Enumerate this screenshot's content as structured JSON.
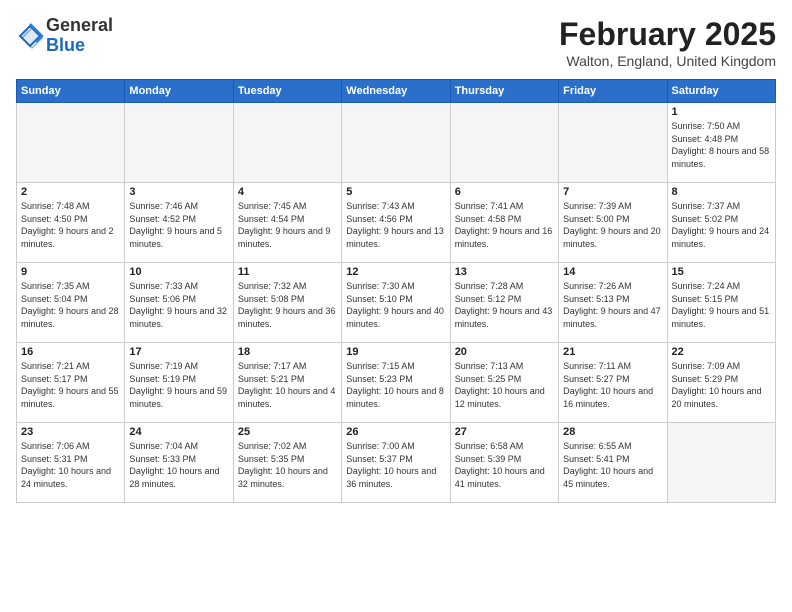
{
  "header": {
    "logo_general": "General",
    "logo_blue": "Blue",
    "month": "February 2025",
    "location": "Walton, England, United Kingdom"
  },
  "weekdays": [
    "Sunday",
    "Monday",
    "Tuesday",
    "Wednesday",
    "Thursday",
    "Friday",
    "Saturday"
  ],
  "weeks": [
    [
      {
        "day": "",
        "info": ""
      },
      {
        "day": "",
        "info": ""
      },
      {
        "day": "",
        "info": ""
      },
      {
        "day": "",
        "info": ""
      },
      {
        "day": "",
        "info": ""
      },
      {
        "day": "",
        "info": ""
      },
      {
        "day": "1",
        "info": "Sunrise: 7:50 AM\nSunset: 4:48 PM\nDaylight: 8 hours and 58 minutes."
      }
    ],
    [
      {
        "day": "2",
        "info": "Sunrise: 7:48 AM\nSunset: 4:50 PM\nDaylight: 9 hours and 2 minutes."
      },
      {
        "day": "3",
        "info": "Sunrise: 7:46 AM\nSunset: 4:52 PM\nDaylight: 9 hours and 5 minutes."
      },
      {
        "day": "4",
        "info": "Sunrise: 7:45 AM\nSunset: 4:54 PM\nDaylight: 9 hours and 9 minutes."
      },
      {
        "day": "5",
        "info": "Sunrise: 7:43 AM\nSunset: 4:56 PM\nDaylight: 9 hours and 13 minutes."
      },
      {
        "day": "6",
        "info": "Sunrise: 7:41 AM\nSunset: 4:58 PM\nDaylight: 9 hours and 16 minutes."
      },
      {
        "day": "7",
        "info": "Sunrise: 7:39 AM\nSunset: 5:00 PM\nDaylight: 9 hours and 20 minutes."
      },
      {
        "day": "8",
        "info": "Sunrise: 7:37 AM\nSunset: 5:02 PM\nDaylight: 9 hours and 24 minutes."
      }
    ],
    [
      {
        "day": "9",
        "info": "Sunrise: 7:35 AM\nSunset: 5:04 PM\nDaylight: 9 hours and 28 minutes."
      },
      {
        "day": "10",
        "info": "Sunrise: 7:33 AM\nSunset: 5:06 PM\nDaylight: 9 hours and 32 minutes."
      },
      {
        "day": "11",
        "info": "Sunrise: 7:32 AM\nSunset: 5:08 PM\nDaylight: 9 hours and 36 minutes."
      },
      {
        "day": "12",
        "info": "Sunrise: 7:30 AM\nSunset: 5:10 PM\nDaylight: 9 hours and 40 minutes."
      },
      {
        "day": "13",
        "info": "Sunrise: 7:28 AM\nSunset: 5:12 PM\nDaylight: 9 hours and 43 minutes."
      },
      {
        "day": "14",
        "info": "Sunrise: 7:26 AM\nSunset: 5:13 PM\nDaylight: 9 hours and 47 minutes."
      },
      {
        "day": "15",
        "info": "Sunrise: 7:24 AM\nSunset: 5:15 PM\nDaylight: 9 hours and 51 minutes."
      }
    ],
    [
      {
        "day": "16",
        "info": "Sunrise: 7:21 AM\nSunset: 5:17 PM\nDaylight: 9 hours and 55 minutes."
      },
      {
        "day": "17",
        "info": "Sunrise: 7:19 AM\nSunset: 5:19 PM\nDaylight: 9 hours and 59 minutes."
      },
      {
        "day": "18",
        "info": "Sunrise: 7:17 AM\nSunset: 5:21 PM\nDaylight: 10 hours and 4 minutes."
      },
      {
        "day": "19",
        "info": "Sunrise: 7:15 AM\nSunset: 5:23 PM\nDaylight: 10 hours and 8 minutes."
      },
      {
        "day": "20",
        "info": "Sunrise: 7:13 AM\nSunset: 5:25 PM\nDaylight: 10 hours and 12 minutes."
      },
      {
        "day": "21",
        "info": "Sunrise: 7:11 AM\nSunset: 5:27 PM\nDaylight: 10 hours and 16 minutes."
      },
      {
        "day": "22",
        "info": "Sunrise: 7:09 AM\nSunset: 5:29 PM\nDaylight: 10 hours and 20 minutes."
      }
    ],
    [
      {
        "day": "23",
        "info": "Sunrise: 7:06 AM\nSunset: 5:31 PM\nDaylight: 10 hours and 24 minutes."
      },
      {
        "day": "24",
        "info": "Sunrise: 7:04 AM\nSunset: 5:33 PM\nDaylight: 10 hours and 28 minutes."
      },
      {
        "day": "25",
        "info": "Sunrise: 7:02 AM\nSunset: 5:35 PM\nDaylight: 10 hours and 32 minutes."
      },
      {
        "day": "26",
        "info": "Sunrise: 7:00 AM\nSunset: 5:37 PM\nDaylight: 10 hours and 36 minutes."
      },
      {
        "day": "27",
        "info": "Sunrise: 6:58 AM\nSunset: 5:39 PM\nDaylight: 10 hours and 41 minutes."
      },
      {
        "day": "28",
        "info": "Sunrise: 6:55 AM\nSunset: 5:41 PM\nDaylight: 10 hours and 45 minutes."
      },
      {
        "day": "",
        "info": ""
      }
    ]
  ]
}
